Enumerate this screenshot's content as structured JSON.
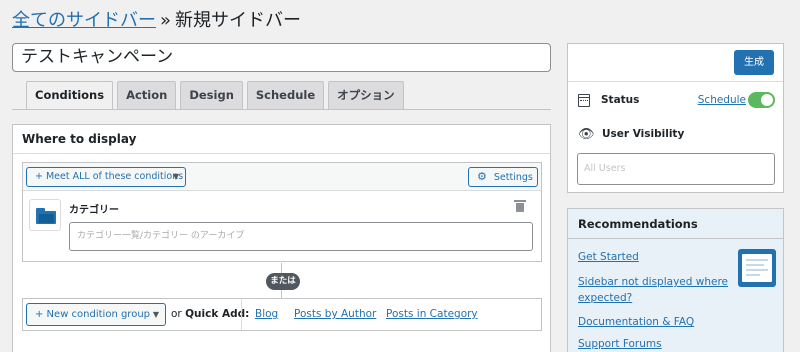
{
  "breadcrumb": {
    "parent": "全てのサイドバー",
    "separator": "»",
    "current": "新規サイドバー"
  },
  "title_input": {
    "value": "テストキャンペーン"
  },
  "tabs": [
    {
      "label": "Conditions",
      "active": true
    },
    {
      "label": "Action",
      "active": false
    },
    {
      "label": "Design",
      "active": false
    },
    {
      "label": "Schedule",
      "active": false
    },
    {
      "label": "オプション",
      "active": false
    }
  ],
  "where_to_display": {
    "title": "Where to display",
    "meet_dropdown": "+ Meet ALL of these conditions",
    "settings_label": "Settings",
    "condition": {
      "label": "カテゴリー",
      "placeholder": "カテゴリー一覧/カテゴリー のアーカイブ",
      "icon": "folder-icon"
    },
    "or_badge": "または",
    "new_group_button": "+ New condition group",
    "quick_add_prefix": "or",
    "quick_add_label": "Quick Add:",
    "quick_add_links": [
      "Blog",
      "Posts by Author",
      "Posts in Category"
    ]
  },
  "publish": {
    "button_label": "生成",
    "status_label": "Status",
    "schedule_link": "Schedule",
    "toggle_on": true,
    "visibility_label": "User Visibility",
    "users_placeholder": "All Users"
  },
  "recommendations": {
    "title": "Recommendations",
    "links": [
      "Get Started",
      "Sidebar not displayed where",
      "expected?",
      "Documentation & FAQ",
      "Support Forums"
    ]
  },
  "colors": {
    "accent": "#2271b1",
    "background": "#f0f0f1",
    "toggle_on": "#5cb85c",
    "recommendations_bg": "#e9f1f8"
  }
}
